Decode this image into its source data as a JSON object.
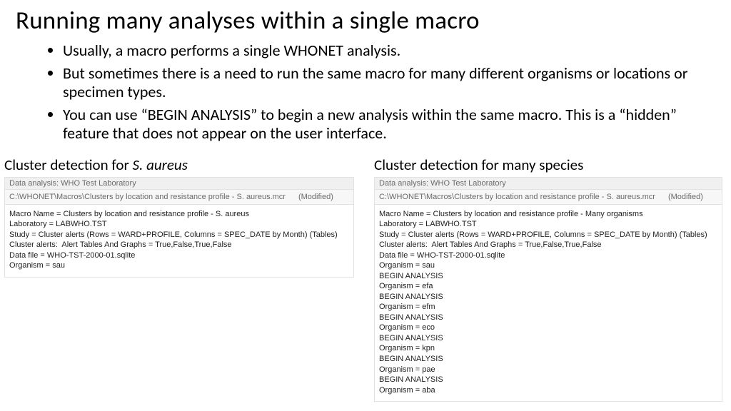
{
  "title": "Running many analyses within a single macro",
  "bullets": [
    "Usually, a macro performs a single WHONET analysis.",
    "But sometimes there is a need to run the same macro for many different organisms or locations or specimen types.",
    "You can use “BEGIN ANALYSIS” to begin a new analysis within the same macro. This is a “hidden” feature that does not appear on the user interface."
  ],
  "left": {
    "heading_prefix": "Cluster detection for ",
    "heading_ital": "S. aureus",
    "panel_header": "Data analysis: WHO Test Laboratory",
    "panel_path": "C:\\WHONET\\Macros\\Clusters by location and resistance profile - S. aureus.mcr",
    "panel_modified": "(Modified)",
    "body": "Macro Name = Clusters by location and resistance profile - S. aureus\nLaboratory = LABWHO.TST\nStudy = Cluster alerts (Rows = WARD+PROFILE, Columns = SPEC_DATE by Month) (Tables)\nCluster alerts:  Alert Tables And Graphs = True,False,True,False\nData file = WHO-TST-2000-01.sqlite\nOrganism = sau"
  },
  "right": {
    "heading": "Cluster detection for many species",
    "panel_header": "Data analysis: WHO Test Laboratory",
    "panel_path": "C:\\WHONET\\Macros\\Clusters by location and resistance profile - S. aureus.mcr",
    "panel_modified": "(Modified)",
    "body": "Macro Name = Clusters by location and resistance profile - Many organisms\nLaboratory = LABWHO.TST\nStudy = Cluster alerts (Rows = WARD+PROFILE, Columns = SPEC_DATE by Month) (Tables)\nCluster alerts:  Alert Tables And Graphs = True,False,True,False\nData file = WHO-TST-2000-01.sqlite\nOrganism = sau\nBEGIN ANALYSIS\nOrganism = efa\nBEGIN ANALYSIS\nOrganism = efm\nBEGIN ANALYSIS\nOrganism = eco\nBEGIN ANALYSIS\nOrganism = kpn\nBEGIN ANALYSIS\nOrganism = pae\nBEGIN ANALYSIS\nOrganism = aba"
  }
}
